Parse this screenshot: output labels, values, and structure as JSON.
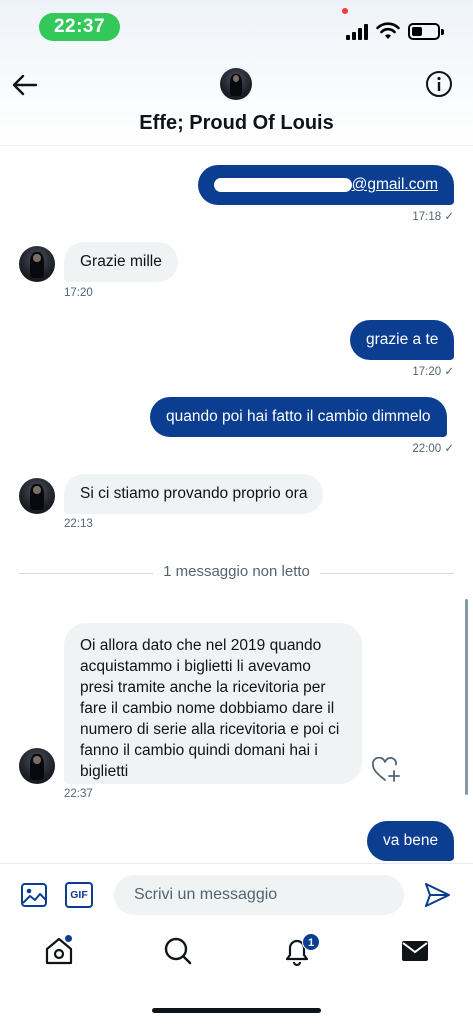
{
  "status_bar": {
    "time": "22:37",
    "battery_level": 0.3
  },
  "header": {
    "title": "Effe; Proud Of Louis",
    "back_icon": "arrow-left-icon",
    "info_icon": "info-circle-icon"
  },
  "messages": {
    "m1": {
      "text_suffix": "@gmail.com",
      "time": "17:18 ✓"
    },
    "m2": {
      "text": "Grazie mille",
      "time": "17:20"
    },
    "m3": {
      "text": "grazie a te",
      "time": "17:20 ✓"
    },
    "m4": {
      "text": "quando poi hai fatto il cambio dimmelo",
      "time": "22:00 ✓"
    },
    "m5": {
      "text": "Si ci stiamo provando proprio ora",
      "time": "22:13"
    },
    "unread_divider": "1 messaggio non letto",
    "m6": {
      "lines": [
        "Oi allora dato che nel 2019 quando",
        "acquistammo i biglietti li avevamo",
        "presi tramite anche la ricevitoria per",
        "fare il cambio nome dobbiamo dare il",
        "numero di serie alla ricevitoria e poi ci",
        "fanno il cambio quindi domani hai i",
        "biglietti"
      ],
      "time": "22:37"
    },
    "m7": {
      "text": "va bene"
    }
  },
  "composer": {
    "placeholder": "Scrivi un messaggio",
    "gif_label": "GIF"
  },
  "tabbar": {
    "notifications_count": "1",
    "icons": [
      "home-icon",
      "search-icon",
      "bell-icon",
      "mail-icon"
    ]
  },
  "colors": {
    "accent": "#0b3d91",
    "incoming_bubble": "#eff3f4",
    "status_green": "#34c759"
  }
}
